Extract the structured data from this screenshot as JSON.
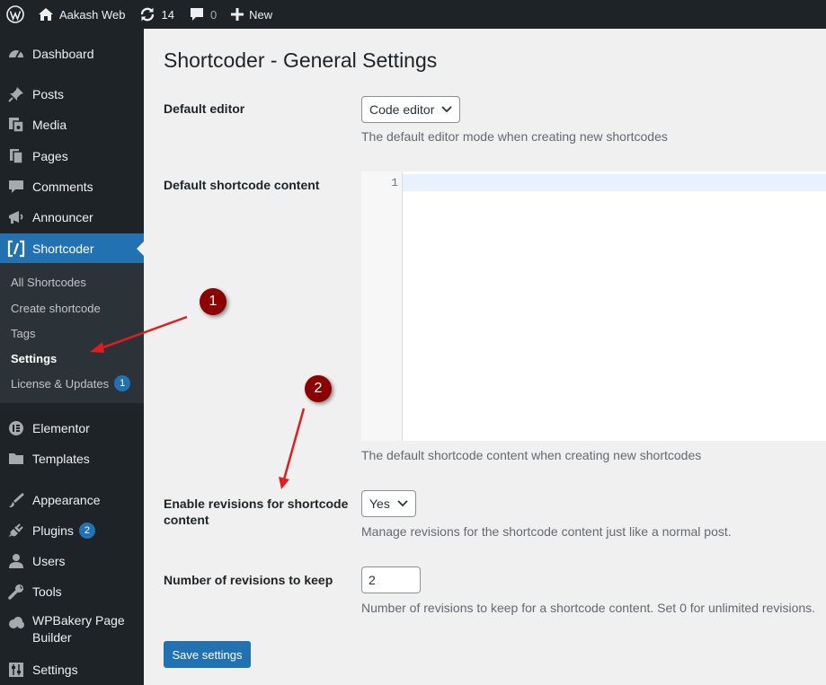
{
  "admin_bar": {
    "site_name": "Aakash Web",
    "updates_count": "14",
    "comments_count": "0",
    "new_label": "New"
  },
  "sidebar": {
    "items": [
      {
        "label": "Dashboard",
        "icon": "dashboard-icon"
      },
      {
        "label": "Posts",
        "icon": "pushpin-icon"
      },
      {
        "label": "Media",
        "icon": "media-icon"
      },
      {
        "label": "Pages",
        "icon": "pages-icon"
      },
      {
        "label": "Comments",
        "icon": "comment-icon"
      },
      {
        "label": "Announcer",
        "icon": "megaphone-icon"
      },
      {
        "label": "Shortcoder",
        "icon": "shortcoder-icon"
      },
      {
        "label": "Elementor",
        "icon": "elementor-icon"
      },
      {
        "label": "Templates",
        "icon": "folder-icon"
      },
      {
        "label": "Appearance",
        "icon": "brush-icon"
      },
      {
        "label": "Plugins",
        "icon": "plug-icon",
        "badge": "2"
      },
      {
        "label": "Users",
        "icon": "user-icon"
      },
      {
        "label": "Tools",
        "icon": "wrench-icon"
      },
      {
        "label_line1": "WPBakery Page",
        "label_line2": "Builder",
        "icon": "cloud-icon"
      },
      {
        "label": "Settings",
        "icon": "sliders-icon"
      }
    ],
    "submenu": [
      {
        "label": "All Shortcodes"
      },
      {
        "label": "Create shortcode"
      },
      {
        "label": "Tags"
      },
      {
        "label": "Settings"
      },
      {
        "label": "License & Updates",
        "badge": "1"
      }
    ]
  },
  "main": {
    "title": "Shortcoder - General Settings",
    "default_editor": {
      "label": "Default editor",
      "value": "Code editor",
      "description": "The default editor mode when creating new shortcodes"
    },
    "default_content": {
      "label": "Default shortcode content",
      "line_number": "1",
      "description": "The default shortcode content when creating new shortcodes"
    },
    "revisions": {
      "label_line1": "Enable revisions for shortcode",
      "label_line2": "content",
      "value": "Yes",
      "description": "Manage revisions for the shortcode content just like a normal post."
    },
    "revisions_count": {
      "label": "Number of revisions to keep",
      "value": "2",
      "description": "Number of revisions to keep for a shortcode content. Set 0 for unlimited revisions."
    },
    "save_label": "Save settings"
  },
  "annotations": {
    "marker1": "1",
    "marker2": "2",
    "marker_color": "#8b0000",
    "arrow_color": "#e11d1d"
  },
  "colors": {
    "admin_dark": "#1d2327",
    "accent": "#2271b1"
  }
}
